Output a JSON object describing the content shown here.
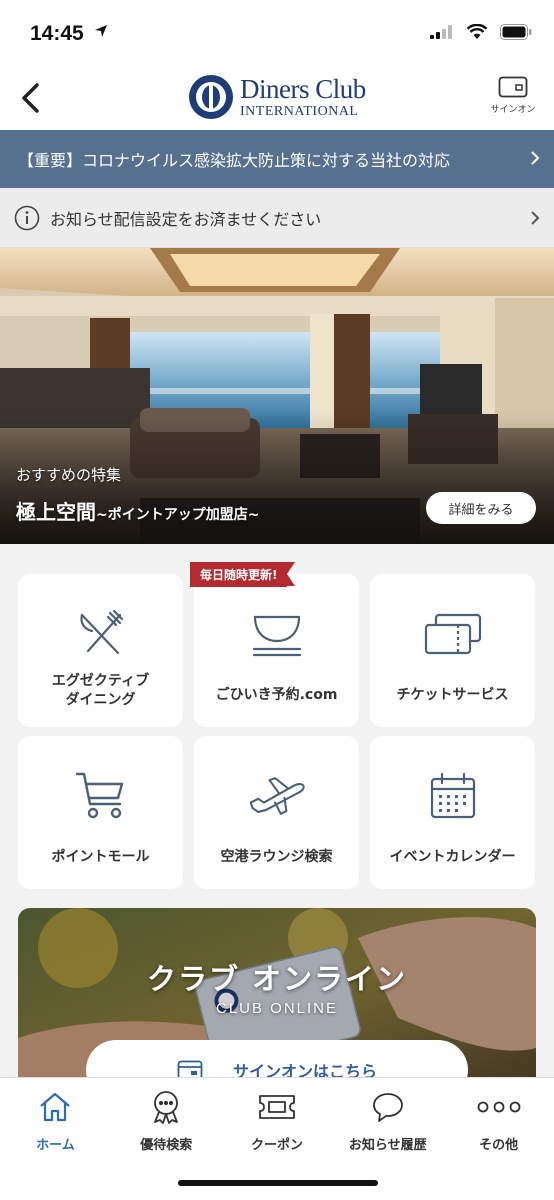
{
  "status_bar": {
    "time": "14:45"
  },
  "header": {
    "logo_main": "Diners Club",
    "logo_sub": "INTERNATIONAL",
    "signin_label": "サインオン"
  },
  "notice_banner": {
    "text": "【重要】コロナウイルス感染拡大防止策に対する当社の対応"
  },
  "info_banner": {
    "text": "お知らせ配信設定をお済ませください"
  },
  "hero": {
    "subtitle": "おすすめの特集",
    "title": "極上空間",
    "title_suffix": "~ポイントアップ加盟店~",
    "button_label": "詳細をみる"
  },
  "menu": {
    "badge": "毎日随時更新!",
    "tiles": [
      {
        "label": "エグゼクティブ\nダイニング",
        "icon": "dining-icon"
      },
      {
        "label": "ごひいき予約.com",
        "icon": "bowl-icon"
      },
      {
        "label": "チケットサービス",
        "icon": "ticket-icon"
      },
      {
        "label": "ポイントモール",
        "icon": "cart-icon"
      },
      {
        "label": "空港ラウンジ検索",
        "icon": "airplane-icon"
      },
      {
        "label": "イベントカレンダー",
        "icon": "calendar-icon"
      }
    ]
  },
  "club_online": {
    "title": "クラブ オンライン",
    "subtitle": "CLUB ONLINE",
    "signin_label": "サインオンはこちら"
  },
  "tabbar": {
    "items": [
      {
        "label": "ホーム",
        "icon": "home-icon",
        "active": true
      },
      {
        "label": "優待検索",
        "icon": "ribbon-icon",
        "active": false
      },
      {
        "label": "クーポン",
        "icon": "coupon-icon",
        "active": false
      },
      {
        "label": "お知らせ履歴",
        "icon": "chat-bubble-icon",
        "active": false
      },
      {
        "label": "その他",
        "icon": "more-icon",
        "active": false
      }
    ]
  },
  "colors": {
    "brand_blue": "#1d3d78",
    "notice_bg": "#56708f",
    "badge_red": "#b52a2f",
    "icon_slate": "#4a607a",
    "active_tab": "#2c6bb6"
  }
}
